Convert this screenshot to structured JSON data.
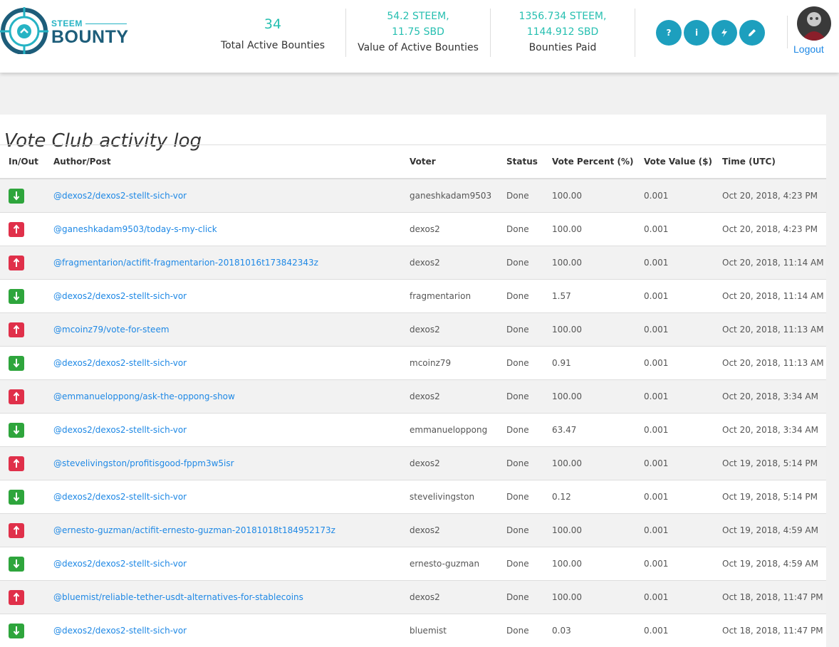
{
  "brand": {
    "small": "STEEM",
    "big": "BOUNTY"
  },
  "stats": [
    {
      "value": "34",
      "label": "Total Active Bounties"
    },
    {
      "value_line1": "54.2 STEEM,",
      "value_line2": "11.75 SBD",
      "label": "Value of Active Bounties"
    },
    {
      "value_line1": "1356.734 STEEM,",
      "value_line2": "1144.912 SBD",
      "label": "Bounties Paid"
    }
  ],
  "nav_icons": [
    {
      "name": "help-icon",
      "glyph": "?"
    },
    {
      "name": "info-icon",
      "glyph": "i"
    },
    {
      "name": "lightning-icon",
      "glyph": ""
    },
    {
      "name": "pencil-icon",
      "glyph": ""
    }
  ],
  "user": {
    "logout_label": "Logout"
  },
  "page": {
    "title": "Vote Club activity log"
  },
  "table": {
    "headers": [
      "In/Out",
      "Author/Post",
      "Voter",
      "Status",
      "Vote Percent (%)",
      "Vote Value ($)",
      "Time (UTC)"
    ],
    "rows": [
      {
        "dir": "in",
        "post": "@dexos2/dexos2-stellt-sich-vor",
        "voter": "ganeshkadam9503",
        "status": "Done",
        "percent": "100.00",
        "value": "0.001",
        "time": "Oct 20, 2018, 4:23 PM"
      },
      {
        "dir": "out",
        "post": "@ganeshkadam9503/today-s-my-click",
        "voter": "dexos2",
        "status": "Done",
        "percent": "100.00",
        "value": "0.001",
        "time": "Oct 20, 2018, 4:23 PM"
      },
      {
        "dir": "out",
        "post": "@fragmentarion/actifit-fragmentarion-20181016t173842343z",
        "voter": "dexos2",
        "status": "Done",
        "percent": "100.00",
        "value": "0.001",
        "time": "Oct 20, 2018, 11:14 AM"
      },
      {
        "dir": "in",
        "post": "@dexos2/dexos2-stellt-sich-vor",
        "voter": "fragmentarion",
        "status": "Done",
        "percent": "1.57",
        "value": "0.001",
        "time": "Oct 20, 2018, 11:14 AM"
      },
      {
        "dir": "out",
        "post": "@mcoinz79/vote-for-steem",
        "voter": "dexos2",
        "status": "Done",
        "percent": "100.00",
        "value": "0.001",
        "time": "Oct 20, 2018, 11:13 AM"
      },
      {
        "dir": "in",
        "post": "@dexos2/dexos2-stellt-sich-vor",
        "voter": "mcoinz79",
        "status": "Done",
        "percent": "0.91",
        "value": "0.001",
        "time": "Oct 20, 2018, 11:13 AM"
      },
      {
        "dir": "out",
        "post": "@emmanueloppong/ask-the-oppong-show",
        "voter": "dexos2",
        "status": "Done",
        "percent": "100.00",
        "value": "0.001",
        "time": "Oct 20, 2018, 3:34 AM"
      },
      {
        "dir": "in",
        "post": "@dexos2/dexos2-stellt-sich-vor",
        "voter": "emmanueloppong",
        "status": "Done",
        "percent": "63.47",
        "value": "0.001",
        "time": "Oct 20, 2018, 3:34 AM"
      },
      {
        "dir": "out",
        "post": "@stevelivingston/profitisgood-fppm3w5isr",
        "voter": "dexos2",
        "status": "Done",
        "percent": "100.00",
        "value": "0.001",
        "time": "Oct 19, 2018, 5:14 PM"
      },
      {
        "dir": "in",
        "post": "@dexos2/dexos2-stellt-sich-vor",
        "voter": "stevelivingston",
        "status": "Done",
        "percent": "0.12",
        "value": "0.001",
        "time": "Oct 19, 2018, 5:14 PM"
      },
      {
        "dir": "out",
        "post": "@ernesto-guzman/actifit-ernesto-guzman-20181018t184952173z",
        "voter": "dexos2",
        "status": "Done",
        "percent": "100.00",
        "value": "0.001",
        "time": "Oct 19, 2018, 4:59 AM"
      },
      {
        "dir": "in",
        "post": "@dexos2/dexos2-stellt-sich-vor",
        "voter": "ernesto-guzman",
        "status": "Done",
        "percent": "100.00",
        "value": "0.001",
        "time": "Oct 19, 2018, 4:59 AM"
      },
      {
        "dir": "out",
        "post": "@bluemist/reliable-tether-usdt-alternatives-for-stablecoins",
        "voter": "dexos2",
        "status": "Done",
        "percent": "100.00",
        "value": "0.001",
        "time": "Oct 18, 2018, 11:47 PM"
      },
      {
        "dir": "in",
        "post": "@dexos2/dexos2-stellt-sich-vor",
        "voter": "bluemist",
        "status": "Done",
        "percent": "0.03",
        "value": "0.001",
        "time": "Oct 18, 2018, 11:47 PM"
      }
    ]
  },
  "colors": {
    "accent": "#26bfb0",
    "nav_button": "#1d9fbe",
    "link": "#1e88e5",
    "in": "#2ea53c",
    "out": "#e0304a",
    "brand_dark": "#1d5d7a"
  }
}
